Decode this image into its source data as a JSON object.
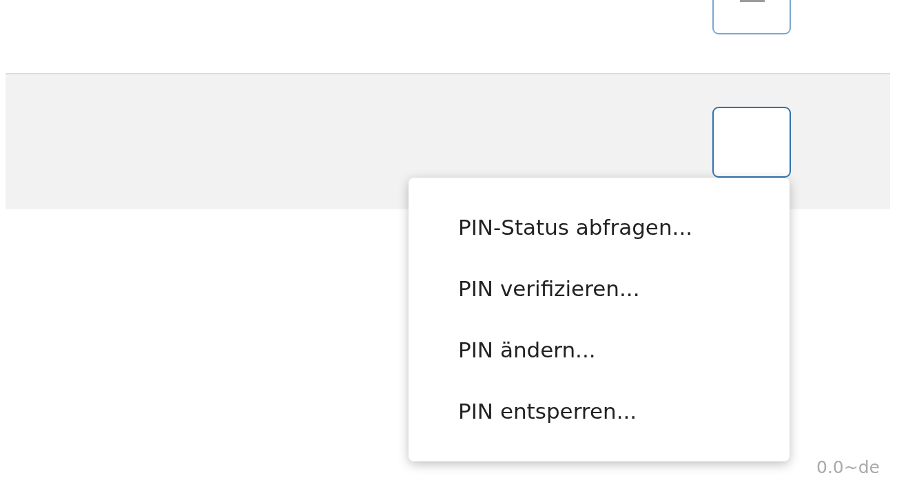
{
  "rows": [
    {
      "selected": false,
      "kind": "dash"
    },
    {
      "selected": true,
      "kind": "blank"
    }
  ],
  "context_menu": {
    "items": [
      {
        "label": "PIN-Status abfragen..."
      },
      {
        "label": "PIN verifizieren..."
      },
      {
        "label": "PIN ändern..."
      },
      {
        "label": "PIN entsperren..."
      }
    ]
  },
  "version": "0.0~de"
}
